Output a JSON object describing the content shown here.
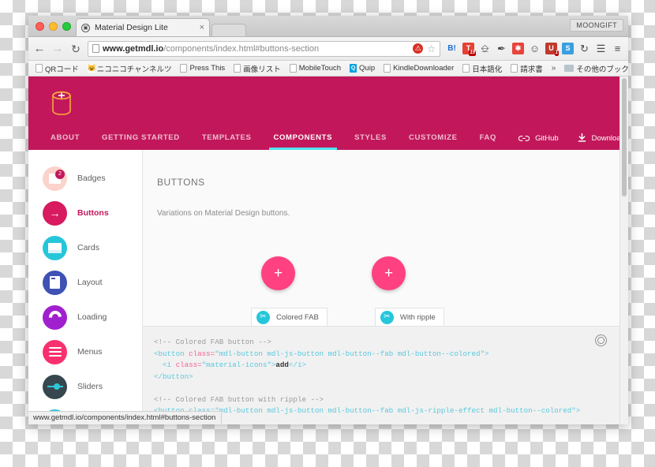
{
  "browser": {
    "profile_label": "MOONGIFT",
    "tab": {
      "title": "Material Design Lite",
      "favicon": "mdl-favicon",
      "close": "×"
    },
    "nav": {
      "back": "←",
      "forward": "→",
      "reload": "↻"
    },
    "omnibox": {
      "url_bold": "www.getmdl.io",
      "url_rest": "/components/index.html#buttons-section",
      "block_icon": "🚫",
      "star_icon": "☆"
    },
    "extensions": [
      {
        "name": "hatena-bookmark-extension",
        "label": "B!",
        "color": "#1c6fd6",
        "bg": "transparent"
      },
      {
        "name": "todoist-extension",
        "label": "T",
        "color": "#ffffff",
        "bg": "#e44232",
        "badge": "19"
      },
      {
        "name": "window-extension",
        "label": "❑",
        "color": "#5a5a5a",
        "bg": "transparent"
      },
      {
        "name": "eyedropper-extension",
        "label": "✒",
        "color": "#3a3a3a",
        "bg": "transparent"
      },
      {
        "name": "asterisk-extension",
        "label": "✱",
        "color": "#ffffff",
        "bg": "#e8453c"
      },
      {
        "name": "smile-extension",
        "label": "☺",
        "color": "#6b6b6b",
        "bg": "transparent"
      },
      {
        "name": "ublock-extension",
        "label": "U",
        "color": "#ffffff",
        "bg": "#c0392b",
        "badge": "1"
      },
      {
        "name": "evernote-extension",
        "label": "S",
        "color": "#ffffff",
        "bg": "#3a9fe0"
      },
      {
        "name": "history-extension",
        "label": "↺",
        "color": "#5a5a5a",
        "bg": "transparent"
      },
      {
        "name": "layers-extension",
        "label": "☰",
        "color": "#3a3a3a",
        "bg": "transparent"
      },
      {
        "name": "chrome-menu",
        "label": "≡",
        "color": "#3a3a3a",
        "bg": "transparent"
      }
    ],
    "bookmarks": [
      {
        "label": "QRコード",
        "icon": "page-icon"
      },
      {
        "label": "ニコニコチャンネルツ",
        "icon": "cat-icon"
      },
      {
        "label": "Press This",
        "icon": "page-icon"
      },
      {
        "label": "画像リスト",
        "icon": "page-icon"
      },
      {
        "label": "MobileTouch",
        "icon": "page-icon"
      },
      {
        "label": "Quip",
        "icon": "quip-icon"
      },
      {
        "label": "KindleDownloader",
        "icon": "page-icon"
      },
      {
        "label": "日本語化",
        "icon": "page-icon"
      },
      {
        "label": "請求書",
        "icon": "page-icon"
      }
    ],
    "bookmarks_overflow": "»",
    "bookmarks_other": {
      "label": "その他のブックマーク",
      "icon": "folder-icon"
    },
    "status_text": "www.getmdl.io/components/index.html#buttons-section"
  },
  "site": {
    "header": {
      "logo": "mdl-logo",
      "nav": [
        {
          "label": "ABOUT",
          "active": false
        },
        {
          "label": "GETTING STARTED",
          "active": false
        },
        {
          "label": "TEMPLATES",
          "active": false
        },
        {
          "label": "COMPONENTS",
          "active": true
        },
        {
          "label": "STYLES",
          "active": false
        },
        {
          "label": "CUSTOMIZE",
          "active": false
        },
        {
          "label": "FAQ",
          "active": false
        }
      ],
      "links": [
        {
          "label": "GitHub",
          "icon": "link-icon"
        },
        {
          "label": "Download",
          "icon": "download-icon"
        }
      ]
    },
    "sidebar": [
      {
        "label": "Badges",
        "icon": "badge-icon",
        "color": "#fbd3cb",
        "active": false
      },
      {
        "label": "Buttons",
        "icon": "arrow-icon",
        "color": "#d81b60",
        "active": true
      },
      {
        "label": "Cards",
        "icon": "card-icon",
        "color": "#26c6da",
        "active": false
      },
      {
        "label": "Layout",
        "icon": "layout-icon",
        "color": "#3f51b5",
        "active": false
      },
      {
        "label": "Loading",
        "icon": "loading-icon",
        "color": "#a020d0",
        "active": false
      },
      {
        "label": "Menus",
        "icon": "menu-icon",
        "color": "#f8306e",
        "active": false
      },
      {
        "label": "Sliders",
        "icon": "slider-icon",
        "color": "#37474f",
        "active": false
      }
    ],
    "sidebar_badge_count": "2",
    "main": {
      "title": "BUTTONS",
      "description": "Variations on Material Design buttons.",
      "demos": [
        {
          "name": "colored-fab",
          "glyph": "+"
        },
        {
          "name": "ripple-fab",
          "glyph": "+"
        }
      ],
      "code_tabs": [
        {
          "label": "Colored FAB",
          "icon": "cut-icon"
        },
        {
          "label": "With ripple",
          "icon": "cut-icon"
        }
      ],
      "code": {
        "line1_comment": "<!-- Colored FAB button -->",
        "line2_tag_open": "<button ",
        "line2_attr": "class=",
        "line2_value": "\"mdl-button mdl-js-button mdl-button--fab mdl-button--colored\"",
        "line2_tag_close": ">",
        "line3_tag_open": "  <i ",
        "line3_attr": "class=",
        "line3_value": "\"material-icons\"",
        "line3_gt": ">",
        "line3_text": "add",
        "line3_close": "</i>",
        "line4": "</button>",
        "line5_comment": "<!-- Colored FAB button with ripple -->",
        "line6": "<button class=\"mdl-button mdl-js-button mdl-button--fab mdl-js-ripple-effect mdl-button--colored\">"
      },
      "settings_icon": "target-icon"
    }
  },
  "colors": {
    "brand_pink": "#c2185b",
    "accent_pink": "#ff4081",
    "tab_underline": "#4fe3f5",
    "teal": "#26c6da"
  }
}
